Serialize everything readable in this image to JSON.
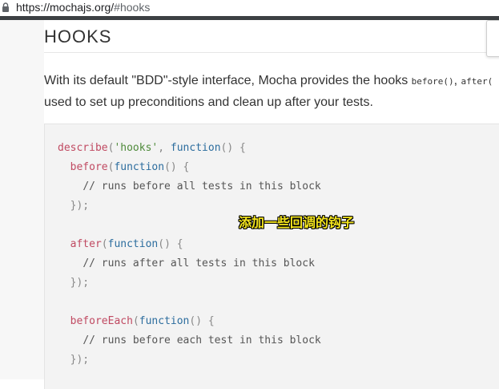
{
  "browser": {
    "url_host": "https://mochajs.org/",
    "url_hash": "#hooks"
  },
  "section": {
    "title": "HOOKS",
    "intro_text": "With its default \"BDD\"-style interface, Mocha provides the hooks ",
    "intro_code1": "before()",
    "intro_sep": ", ",
    "intro_code2": "after(",
    "intro_line2": "used to set up preconditions and clean up after your tests."
  },
  "code": {
    "l1_fn": "describe",
    "l1_open": "(",
    "l1_str": "'hooks'",
    "l1_comma": ", ",
    "l1_kw": "function",
    "l1_tail": "() {",
    "l2_fn": "before",
    "l2_open": "(",
    "l2_kw": "function",
    "l2_tail": "() {",
    "l3_cm": "// runs before all tests in this block",
    "l4_close": "});",
    "l6_fn": "after",
    "l6_open": "(",
    "l6_kw": "function",
    "l6_tail": "() {",
    "l7_cm": "// runs after all tests in this block",
    "l8_close": "});",
    "l10_fn": "beforeEach",
    "l10_open": "(",
    "l10_kw": "function",
    "l10_tail": "() {",
    "l11_cm": "// runs before each test in this block",
    "l12_close": "});"
  },
  "overlay": {
    "subtitle": "添加一些回调的钩子"
  },
  "colors": {
    "fn": "#c04a62",
    "keyword": "#2c6d9e",
    "string": "#4e8a3a",
    "subtitle": "#f5e61e"
  }
}
